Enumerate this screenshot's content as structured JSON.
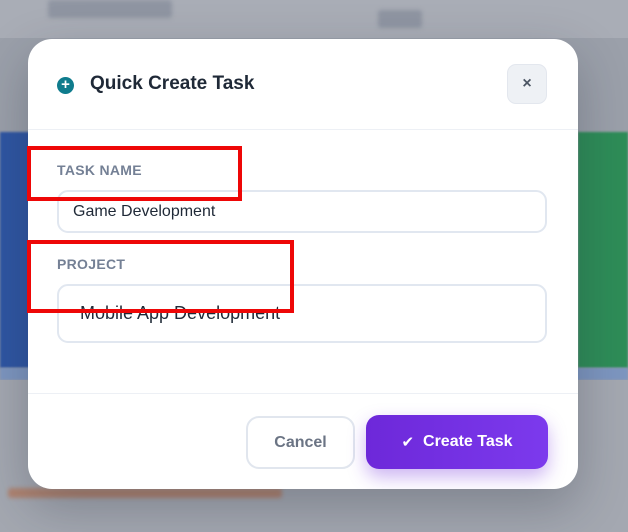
{
  "modal": {
    "title": "Quick Create Task",
    "header_icon": "plus-circle-icon",
    "close_icon": "close-icon",
    "close_glyph": "×"
  },
  "form": {
    "task_name": {
      "label": "TASK NAME",
      "value": "Game Development"
    },
    "project": {
      "label": "PROJECT",
      "value": "Mobile App Development"
    }
  },
  "footer": {
    "cancel_label": "Cancel",
    "create_label": "Create Task",
    "create_icon": "check-icon"
  },
  "colors": {
    "accent": "#6d28d9",
    "header_icon": "#0f7c8d",
    "highlight": "#ee0707"
  }
}
